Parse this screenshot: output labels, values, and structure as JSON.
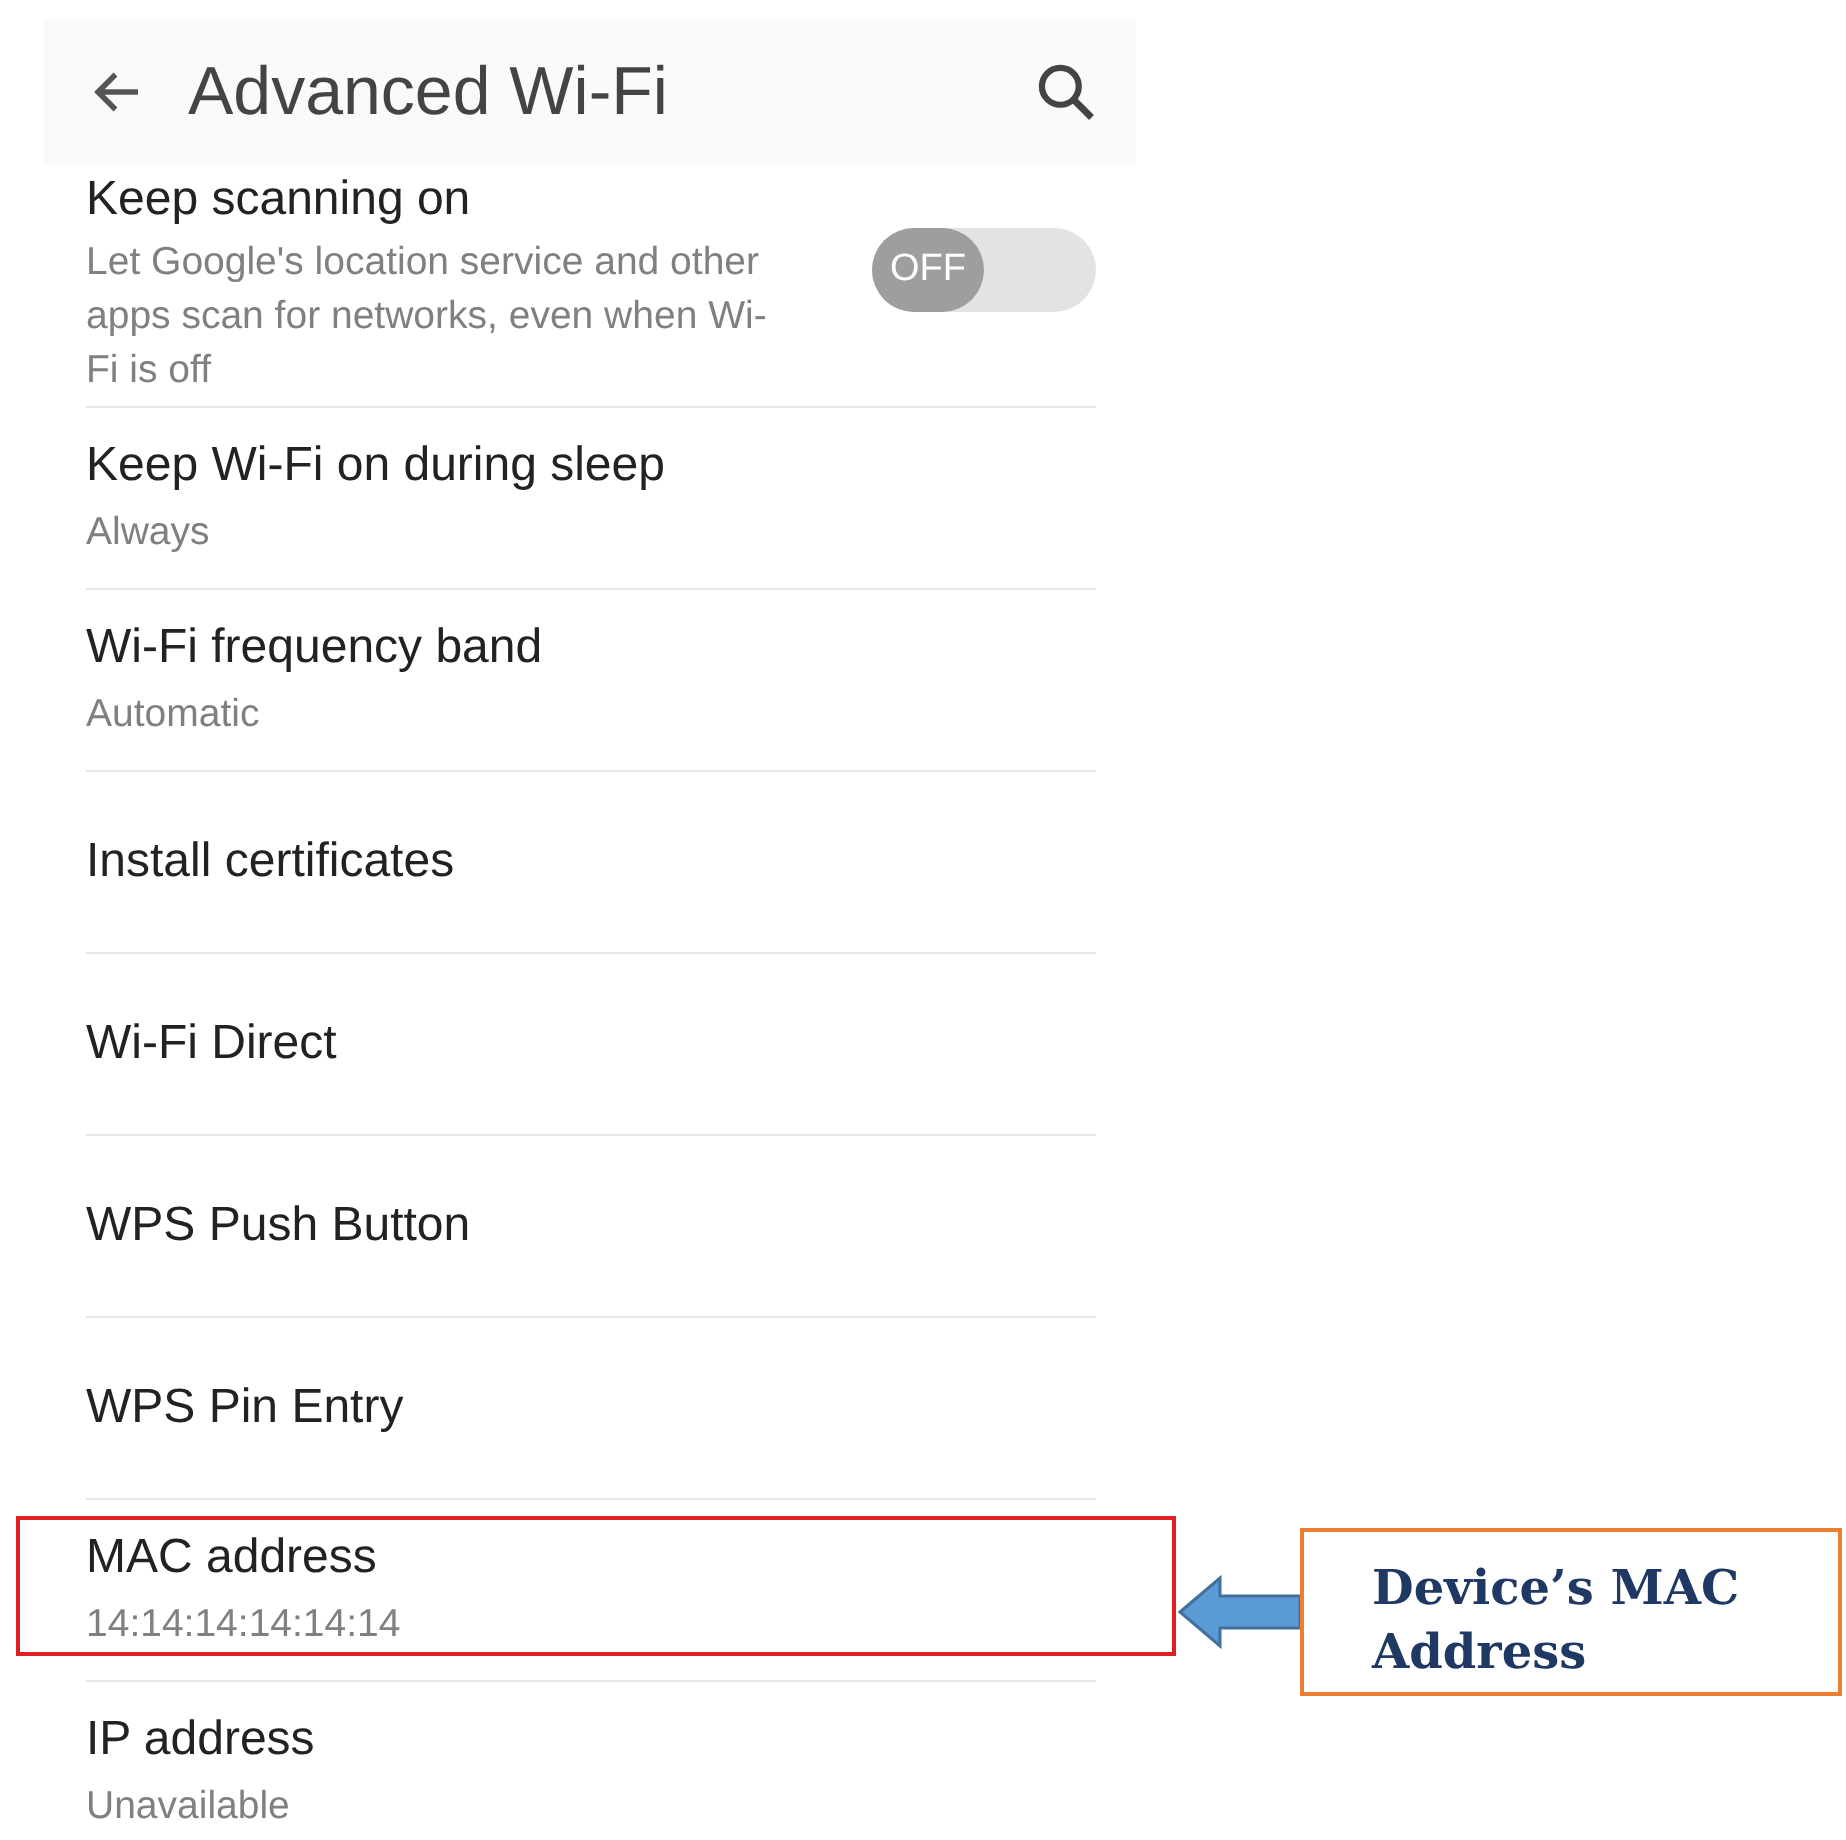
{
  "header": {
    "title": "Advanced Wi-Fi"
  },
  "settings": [
    {
      "kind": "toggle",
      "title": "Keep scanning on",
      "summary": "Let Google's location service and other apps scan for networks, even when Wi-Fi is off",
      "on": false,
      "toggle_label": "OFF",
      "highlighted": false
    },
    {
      "kind": "plain",
      "title": "Keep Wi-Fi on during sleep",
      "summary": "Always",
      "highlighted": false
    },
    {
      "kind": "plain",
      "title": "Wi-Fi frequency band",
      "summary": "Automatic",
      "highlighted": false
    },
    {
      "kind": "plain",
      "title": "Install certificates",
      "highlighted": false
    },
    {
      "kind": "plain",
      "title": "Wi-Fi Direct",
      "highlighted": false
    },
    {
      "kind": "plain",
      "title": "WPS Push Button",
      "highlighted": false
    },
    {
      "kind": "plain",
      "title": "WPS Pin Entry",
      "highlighted": false
    },
    {
      "kind": "plain",
      "title": "MAC address",
      "summary": "14:14:14:14:14:14",
      "highlighted": true
    },
    {
      "kind": "plain",
      "title": "IP address",
      "summary": "Unavailable",
      "highlighted": false
    }
  ],
  "callout": {
    "text": "Device’s MAC Address"
  }
}
